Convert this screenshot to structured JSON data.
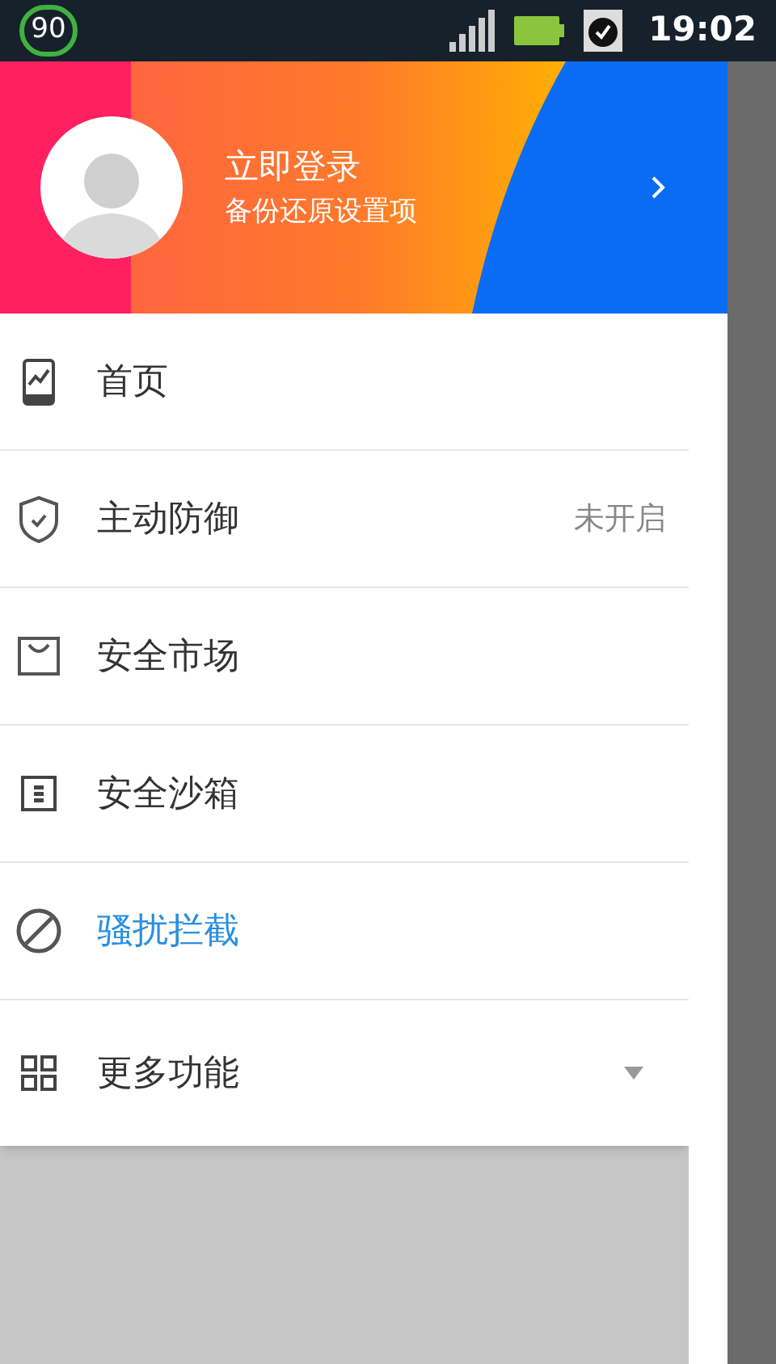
{
  "status_bar": {
    "badge": "90",
    "time": "19:02"
  },
  "header": {
    "title": "立即登录",
    "subtitle": "备份还原设置项"
  },
  "menu": {
    "items": [
      {
        "kind": "home",
        "label": "首页",
        "selected": false
      },
      {
        "kind": "shield",
        "label": "主动防御",
        "selected": false,
        "status": "未开启"
      },
      {
        "kind": "bag",
        "label": "安全市场",
        "selected": false
      },
      {
        "kind": "sandbox",
        "label": "安全沙箱",
        "selected": false
      },
      {
        "kind": "block",
        "label": "骚扰拦截",
        "selected": true
      }
    ],
    "more": {
      "label": "更多功能",
      "expanded": false
    }
  }
}
